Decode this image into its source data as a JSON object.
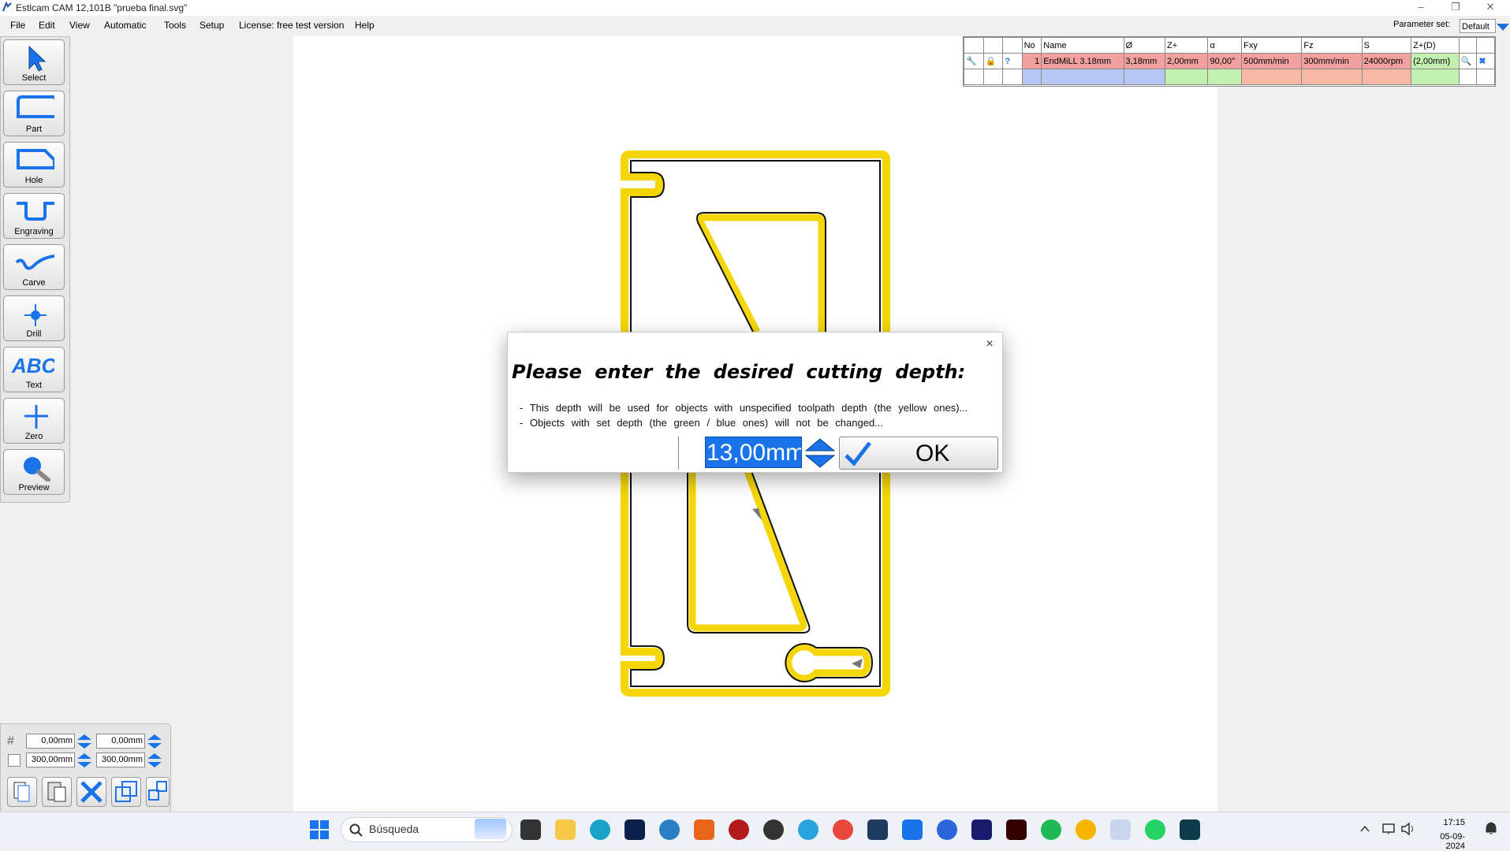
{
  "window": {
    "title": "Estlcam CAM 12,101B \"prueba final.svg\""
  },
  "menu": [
    "File",
    "Edit",
    "View",
    "Automatic",
    "Tools",
    "Setup",
    "License: free test version",
    "Help"
  ],
  "parameter_set": {
    "label": "Parameter set:",
    "value": "Default"
  },
  "toolbar": [
    {
      "label": "Select",
      "icon": "arrow-pointer-icon"
    },
    {
      "label": "Part",
      "icon": "part-outline-icon"
    },
    {
      "label": "Hole",
      "icon": "hole-outline-icon"
    },
    {
      "label": "Engraving",
      "icon": "engraving-icon"
    },
    {
      "label": "Carve",
      "icon": "carve-icon"
    },
    {
      "label": "Drill",
      "icon": "drill-icon"
    },
    {
      "label": "Text",
      "icon": "text-abc-icon"
    },
    {
      "label": "Zero",
      "icon": "zero-crosshair-icon"
    },
    {
      "label": "Preview",
      "icon": "magnifier-icon"
    }
  ],
  "tool_table": {
    "headers": [
      "No",
      "Name",
      "Ø",
      "Z+",
      "α",
      "Fxy",
      "Fz",
      "S",
      "Z+(D)"
    ],
    "row": {
      "no": "1",
      "name": "EndMiLL 3.18mm",
      "diameter": "3,18mm",
      "z_step": "2,00mm",
      "angle": "90,00°",
      "fxy": "500mm/min",
      "fz": "300mm/min",
      "s": "24000rpm",
      "z_d": "(2,00mm)"
    },
    "colors": {
      "row_red": "#f2a0a0",
      "row_green": "#c3f0b0",
      "row_blue": "#b7c7f5",
      "row_salmon": "#f7b9a6"
    }
  },
  "dialog": {
    "heading": "Please enter the desired cutting depth:",
    "line1": "- This depth will be used for objects with unspecified toolpath depth (the yellow ones)...",
    "line2": "- Objects with set depth (the green / blue ones) will not be changed...",
    "depth_value": "13,00mm",
    "ok_label": "OK",
    "close": "×"
  },
  "coords": {
    "grid_x": "0,00mm",
    "grid_y": "0,00mm",
    "size_x": "300,00mm",
    "size_y": "300,00mm"
  },
  "taskbar": {
    "search_placeholder": "Búsqueda",
    "time": "17:15",
    "date": "05-09-2024"
  },
  "accent": {
    "toolpath_yellow": "#f5d60a",
    "select_blue": "#1a73e8"
  }
}
